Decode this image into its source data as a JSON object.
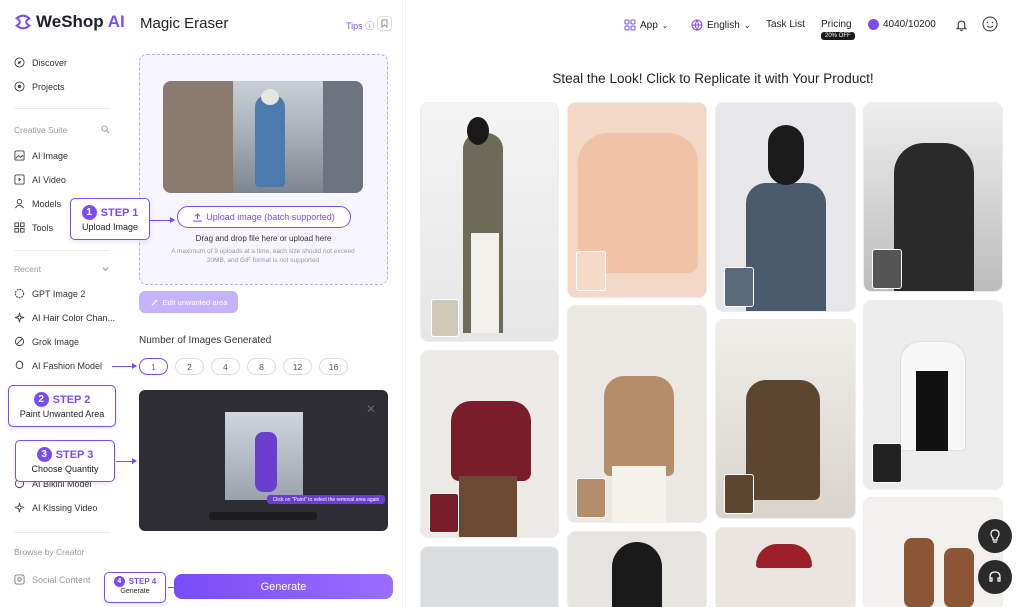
{
  "brand": {
    "name": "WeShop",
    "suffix": "AI"
  },
  "sidebar": {
    "top_items": [
      {
        "label": "Discover",
        "icon": "compass-icon"
      },
      {
        "label": "Projects",
        "icon": "folder-icon"
      }
    ],
    "creative_suite_title": "Creative Suite",
    "creative_items": [
      {
        "label": "AI Image",
        "icon": "image-icon"
      },
      {
        "label": "AI Video",
        "icon": "video-icon"
      },
      {
        "label": "Models",
        "icon": "model-icon"
      },
      {
        "label": "Tools",
        "icon": "tools-icon"
      }
    ],
    "recent_title": "Recent",
    "recent_items": [
      {
        "label": "GPT Image 2",
        "icon": "gpt-icon"
      },
      {
        "label": "AI Hair Color Chan...",
        "icon": "sparkle-icon"
      },
      {
        "label": "Grok Image",
        "icon": "grok-icon"
      },
      {
        "label": "AI Fashion Model",
        "icon": "fashion-icon"
      },
      {
        "label": "AI Bikini Model",
        "icon": "bikini-icon"
      },
      {
        "label": "AI Kissing Video",
        "icon": "sparkle-icon"
      }
    ],
    "browse_title": "Browse by Creator",
    "browse_items": [
      {
        "label": "Social Content",
        "icon": "social-icon"
      }
    ]
  },
  "panel": {
    "title": "Magic Eraser",
    "tips": "Tips",
    "upload_button": "Upload image (batch supported)",
    "drag_text": "Drag and drop file here or upload here",
    "limit_text": "A maximum of 9 uploads at a time, each size should not exceed 20MB, and GIF format is not supported",
    "edit_button": "Edit unwanted area",
    "num_title": "Number of Images Generated",
    "num_options": [
      "1",
      "2",
      "4",
      "8",
      "12",
      "16"
    ],
    "video_tip": "Click on \"Paint\" to select the removal area again",
    "generate_label": "Generate"
  },
  "steps": [
    {
      "num": "1",
      "title": "STEP 1",
      "sub": "Upload Image"
    },
    {
      "num": "2",
      "title": "STEP 2",
      "sub": "Paint Unwanted Area"
    },
    {
      "num": "3",
      "title": "STEP 3",
      "sub": "Choose Quantity"
    },
    {
      "num": "4",
      "title": "STEP 4",
      "sub": "Generate"
    }
  ],
  "header": {
    "app": "App",
    "language": "English",
    "task_list": "Task List",
    "pricing": "Pricing",
    "pricing_badge": "20% OFF",
    "credits": "4040/10200"
  },
  "gallery": {
    "title": "Steal the Look! Click to Replicate it with Your Product!"
  },
  "colors": {
    "accent": "#7a4cf6",
    "generate": "#8a5bfb"
  }
}
